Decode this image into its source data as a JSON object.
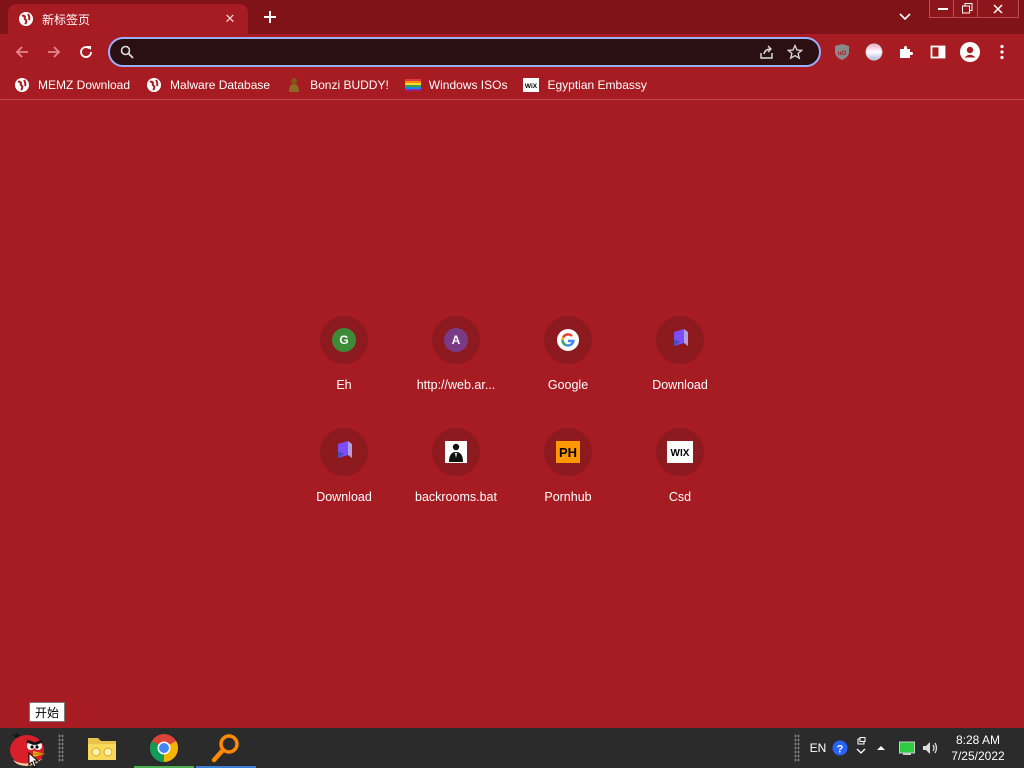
{
  "tab": {
    "title": "新标签页",
    "favicon": "globe-icon"
  },
  "toolbar": {
    "omnibox_value": "",
    "icons": [
      "back-icon",
      "forward-icon",
      "reload-icon",
      "search-icon",
      "share-icon",
      "star-icon"
    ]
  },
  "extensions": [
    "ublock-icon",
    "gradient-ball-icon",
    "puzzle-icon",
    "side-panel-icon",
    "profile-icon",
    "kebab-menu-icon"
  ],
  "bookmarks": [
    {
      "label": "MEMZ Download",
      "icon": "globe-icon"
    },
    {
      "label": "Malware Database",
      "icon": "globe-icon"
    },
    {
      "label": "Bonzi BUDDY!",
      "icon": "bonzi-icon"
    },
    {
      "label": "Windows ISOs",
      "icon": "rainbow-icon"
    },
    {
      "label": "Egyptian Embassy",
      "icon": "wix-icon"
    }
  ],
  "tiles": [
    {
      "label": "Eh",
      "icon": "letter-g",
      "letter": "G"
    },
    {
      "label": "http://web.ar...",
      "icon": "letter-a",
      "letter": "A"
    },
    {
      "label": "Google",
      "icon": "google-icon"
    },
    {
      "label": "Download",
      "icon": "cube-icon"
    },
    {
      "label": "Download",
      "icon": "cube-icon"
    },
    {
      "label": "backrooms.bat",
      "icon": "person-icon"
    },
    {
      "label": "Pornhub",
      "icon": "ph-icon",
      "text": "PH"
    },
    {
      "label": "Csd",
      "icon": "wix-icon",
      "text": "WIX"
    }
  ],
  "start_tooltip": "开始",
  "taskbar": {
    "apps": [
      "angry-bird-start-icon",
      "file-explorer-icon",
      "chrome-icon",
      "search-magnifier-icon"
    ],
    "tray": {
      "language": "EN",
      "icons": [
        "help-icon",
        "network-icon",
        "chevron-up-icon",
        "battery-icon",
        "volume-icon"
      ]
    },
    "clock": {
      "time": "8:28 AM",
      "date": "7/25/2022"
    }
  },
  "colors": {
    "frame": "#7f1318",
    "toolbar": "#a71b22",
    "omnibox": "#2a1012",
    "focus_ring": "#9ab0ff",
    "taskbar": "#2b2b2b"
  }
}
